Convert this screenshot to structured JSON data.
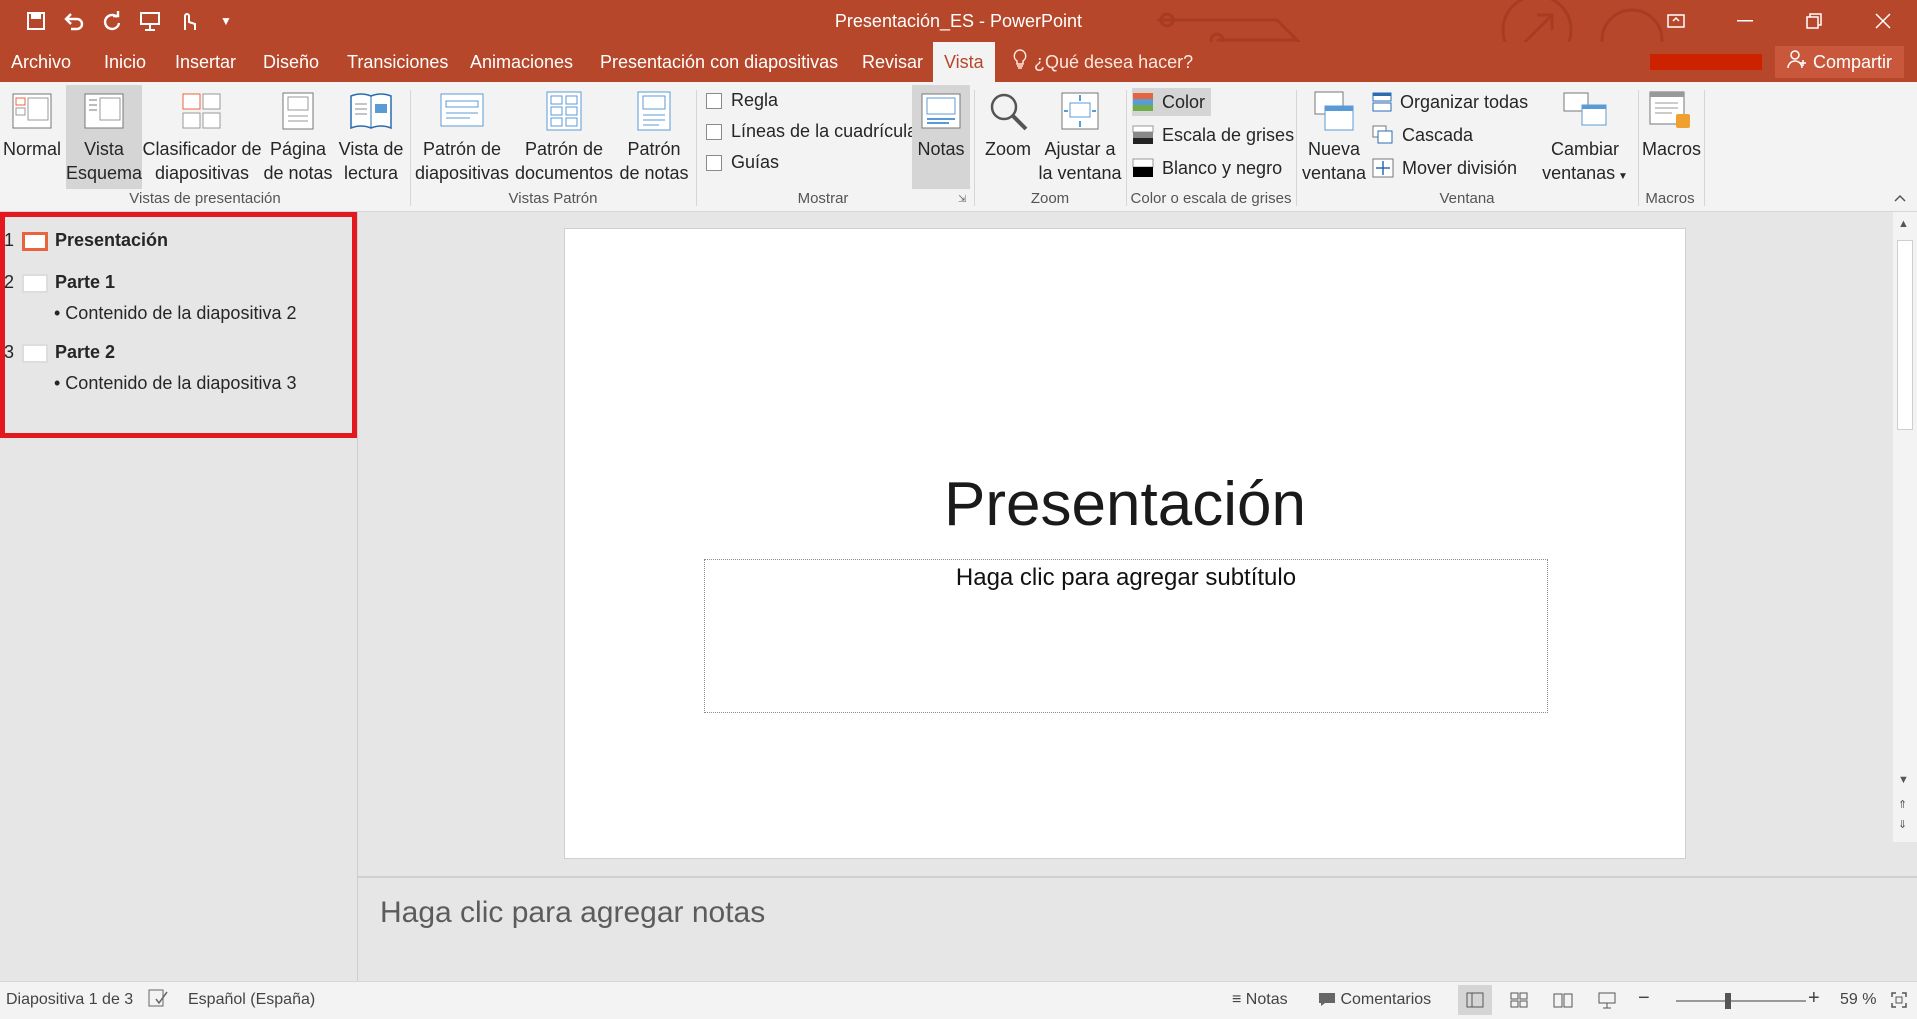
{
  "window": {
    "title": "Presentación_ES - PowerPoint",
    "accent": "#b7472a"
  },
  "qat": {
    "icons": [
      "save-icon",
      "undo-icon",
      "redo-icon",
      "start-from-beginning-icon",
      "touch-mode-icon",
      "customize-icon"
    ]
  },
  "menu": {
    "tabs": [
      "Archivo",
      "Inicio",
      "Insertar",
      "Diseño",
      "Transiciones",
      "Animaciones",
      "Presentación con diapositivas",
      "Revisar",
      "Vista"
    ],
    "active": "Vista",
    "tellme": "¿Qué desea hacer?",
    "share": "Compartir"
  },
  "ribbon": {
    "vistas_presentacion": {
      "label": "Vistas de presentación",
      "normal": "Normal",
      "esquema_1": "Vista",
      "esquema_2": "Esquema",
      "clasificador_1": "Clasificador de",
      "clasificador_2": "diapositivas",
      "pagina_1": "Página",
      "pagina_2": "de notas",
      "lectura_1": "Vista de",
      "lectura_2": "lectura"
    },
    "vistas_patron": {
      "label": "Vistas Patrón",
      "p1_1": "Patrón de",
      "p1_2": "diapositivas",
      "p2_1": "Patrón de",
      "p2_2": "documentos",
      "p3_1": "Patrón",
      "p3_2": "de notas"
    },
    "mostrar": {
      "label": "Mostrar",
      "regla": "Regla",
      "lineas": "Líneas de la cuadrícula",
      "guias": "Guías",
      "notas": "Notas"
    },
    "zoom": {
      "label": "Zoom",
      "zoom": "Zoom",
      "ajustar_1": "Ajustar a",
      "ajustar_2": "la ventana"
    },
    "color": {
      "label": "Color o escala de grises",
      "color": "Color",
      "grises": "Escala de grises",
      "bn": "Blanco y negro"
    },
    "ventana": {
      "label": "Ventana",
      "nueva_1": "Nueva",
      "nueva_2": "ventana",
      "organizar": "Organizar todas",
      "cascada": "Cascada",
      "mover": "Mover división",
      "cambiar_1": "Cambiar",
      "cambiar_2": "ventanas"
    },
    "macros": {
      "label": "Macros",
      "macros": "Macros"
    }
  },
  "outline": {
    "slides": [
      {
        "num": "1",
        "title": "Presentación",
        "bullets": []
      },
      {
        "num": "2",
        "title": "Parte 1",
        "bullets": [
          "• Contenido de la diapositiva 2"
        ]
      },
      {
        "num": "3",
        "title": "Parte 2",
        "bullets": [
          "• Contenido de la diapositiva 3"
        ]
      }
    ]
  },
  "slide": {
    "title": "Presentación",
    "subtitle_placeholder": "Haga clic para agregar subtítulo"
  },
  "notes": {
    "placeholder": "Haga clic para agregar notas"
  },
  "status": {
    "slide_info": "Diapositiva 1 de 3",
    "language": "Español (España)",
    "notes": "Notas",
    "comments": "Comentarios",
    "zoom": "59 %"
  }
}
